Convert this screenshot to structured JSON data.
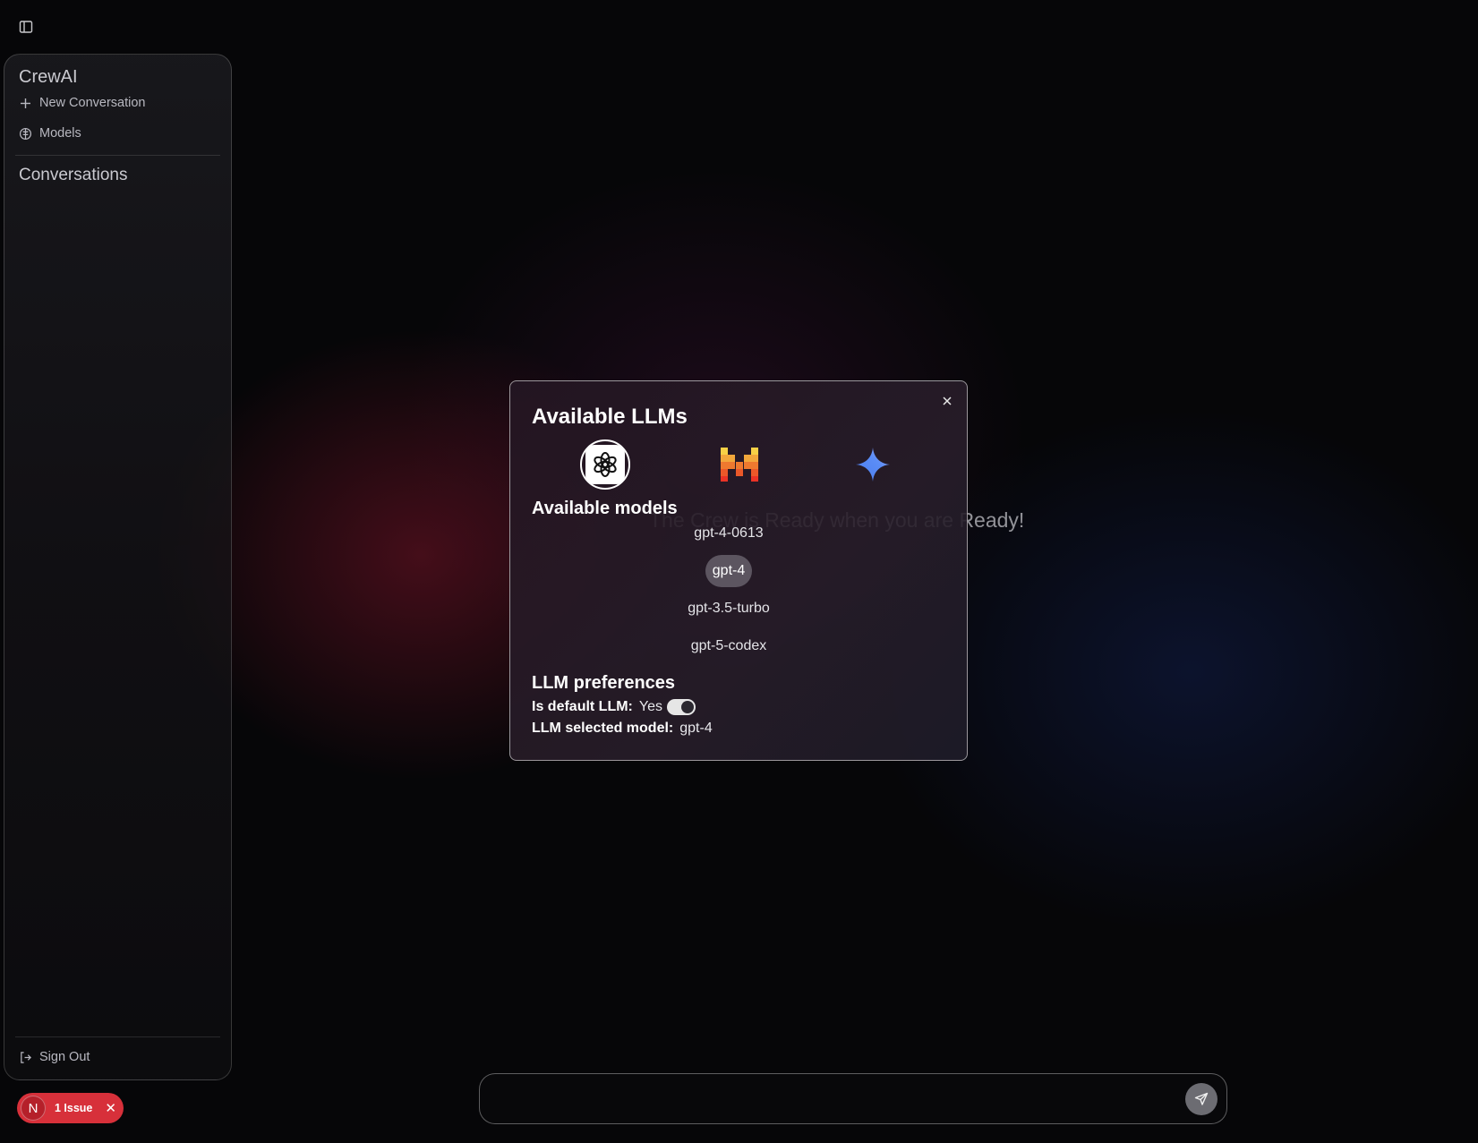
{
  "sidebar": {
    "app_title": "CrewAI",
    "new_conversation": "New Conversation",
    "models": "Models",
    "conversations_heading": "Conversations",
    "sign_out": "Sign Out"
  },
  "issue_badge": {
    "avatar_letter": "N",
    "label": "1 Issue",
    "close_glyph": "✕",
    "color": "#d7303a"
  },
  "main": {
    "ready_message": "The Crew is Ready when you are Ready!",
    "chat_placeholder": ""
  },
  "modal": {
    "title": "Available LLMs",
    "providers": [
      {
        "icon": "openai-logo-icon",
        "selected": true
      },
      {
        "icon": "mistral-logo-icon",
        "selected": false
      },
      {
        "icon": "gemini-logo-icon",
        "selected": false
      }
    ],
    "available_models_heading": "Available models",
    "models": [
      "gpt-4-0613",
      "gpt-4",
      "gpt-3.5-turbo",
      "gpt-5-codex"
    ],
    "selected_model_index": 1,
    "preferences_heading": "LLM preferences",
    "is_default_label": "Is default LLM:",
    "is_default_value": "Yes",
    "is_default_toggle_on": true,
    "selected_model_label": "LLM selected model:",
    "selected_model_value": "gpt-4"
  },
  "colors": {
    "background": "#060608",
    "accent_red": "#d7303a",
    "selected_pill": "#5c5560"
  }
}
